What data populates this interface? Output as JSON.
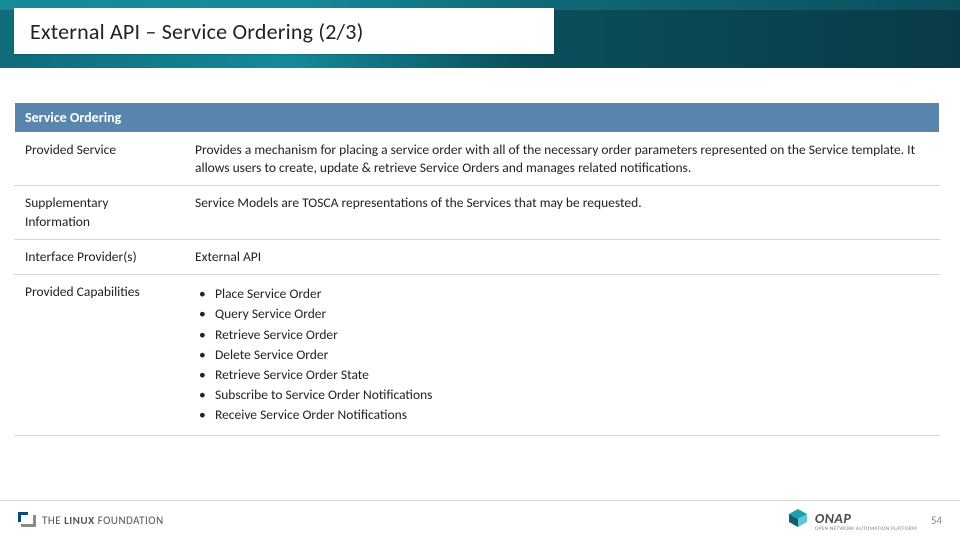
{
  "title": "External API – Service Ordering (2/3)",
  "section_header": "Service Ordering",
  "rows": {
    "provided_service": {
      "label": "Provided Service",
      "value": "Provides a mechanism for placing a service order with all of the necessary order parameters represented on the Service template. It allows users to create, update & retrieve Service Orders and manages related notifications."
    },
    "supplementary": {
      "label": "Supplementary Information",
      "value": "Service Models are TOSCA representations of the Services that may be requested."
    },
    "interface_providers": {
      "label": "Interface Provider(s)",
      "value": "External API"
    },
    "capabilities": {
      "label": "Provided Capabilities",
      "items": [
        "Place Service Order",
        "Query Service Order",
        "Retrieve Service Order",
        "Delete Service Order",
        "Retrieve Service Order State",
        "Subscribe to Service Order Notifications",
        "Receive Service Order Notifications"
      ]
    }
  },
  "footer": {
    "linux_foundation": "THE LINUX FOUNDATION",
    "onap": "ONAP",
    "onap_sub": "OPEN NETWORK AUTOMATION PLATFORM",
    "page": "54"
  }
}
